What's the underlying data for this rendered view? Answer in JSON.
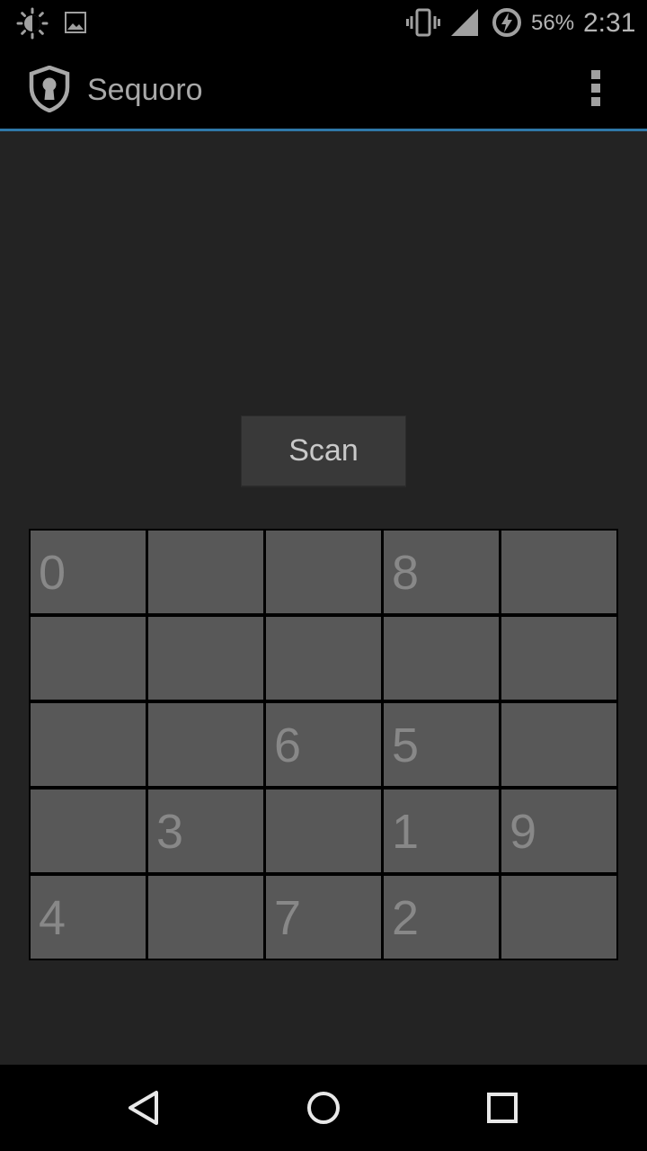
{
  "status_bar": {
    "battery_percent": "56%",
    "time": "2:31",
    "icons": [
      "brightness-icon",
      "image-notification-icon",
      "vibrate-icon",
      "signal-icon",
      "battery-charging-icon"
    ]
  },
  "app_bar": {
    "title": "Sequoro",
    "logo_icon": "shield-keyhole-icon",
    "menu_icon": "overflow-menu-icon"
  },
  "main": {
    "scan_label": "Scan",
    "grid": [
      [
        "0",
        "",
        "",
        "8",
        ""
      ],
      [
        "",
        "",
        "",
        "",
        ""
      ],
      [
        "",
        "",
        "6",
        "5",
        ""
      ],
      [
        "",
        "3",
        "",
        "1",
        "9"
      ],
      [
        "4",
        "",
        "7",
        "2",
        ""
      ]
    ]
  },
  "nav_bar": {
    "icons": [
      "back-icon",
      "home-icon",
      "recents-icon"
    ]
  },
  "colors": {
    "background": "#232323",
    "accent_line": "#2f78a8",
    "cell": "#585858",
    "cell_text": "#888888"
  }
}
